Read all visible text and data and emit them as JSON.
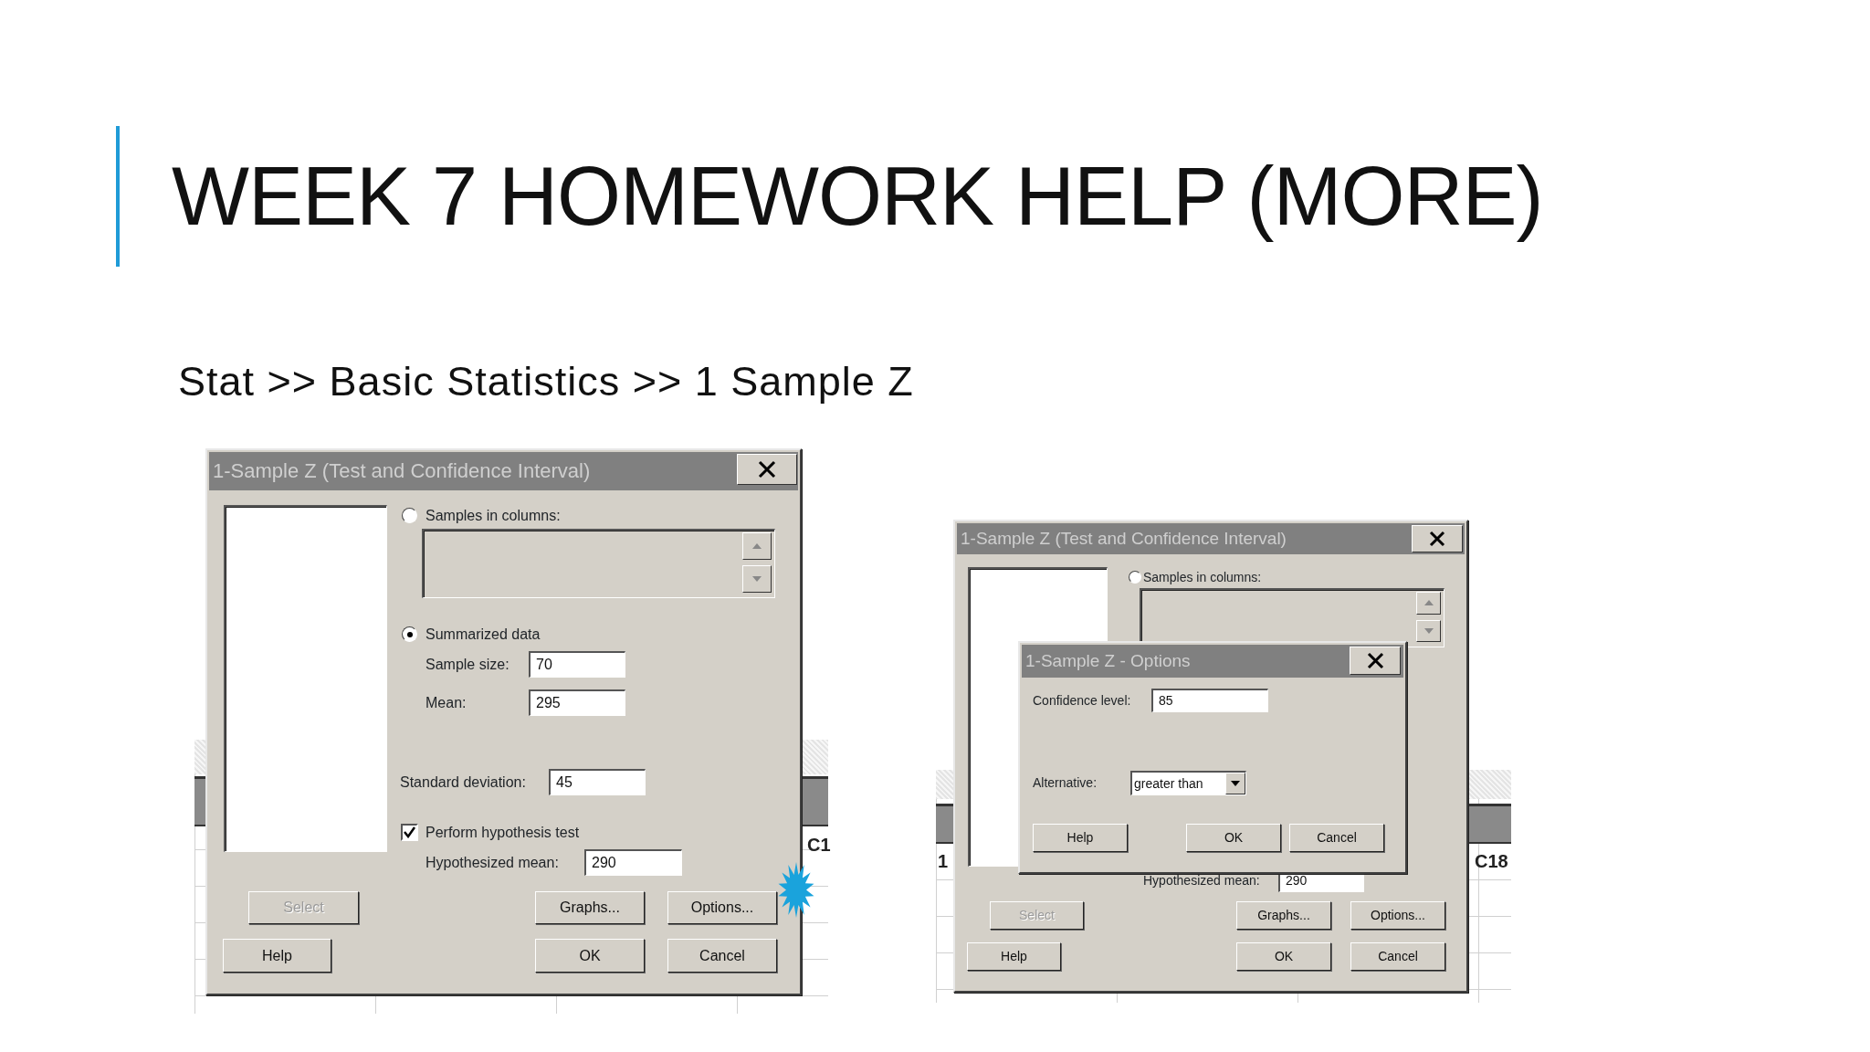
{
  "slide": {
    "title": "WEEK 7 HOMEWORK HELP (MORE)",
    "subtitle": "Stat >> Basic Statistics >> 1 Sample Z"
  },
  "worksheets": [
    {
      "labels": [
        "C1"
      ]
    },
    {
      "labels": [
        "1",
        "C18"
      ]
    }
  ],
  "dialogs": [
    {
      "title": "1-Sample Z (Test and Confidence Interval)",
      "items": [
        {
          "kind": "radio",
          "label": "Samples in columns:",
          "selected": false
        },
        {
          "kind": "radio",
          "label": "Summarized data",
          "selected": true
        },
        {
          "kind": "field",
          "label": "Sample size:",
          "value": "70"
        },
        {
          "kind": "field",
          "label": "Mean:",
          "value": "295"
        },
        {
          "kind": "field",
          "label": "Standard deviation:",
          "value": "45"
        },
        {
          "kind": "checkbox",
          "label": "Perform hypothesis test",
          "checked": true
        },
        {
          "kind": "field",
          "label": "Hypothesized mean:",
          "value": "290"
        },
        {
          "kind": "button",
          "label": "Select",
          "disabled": true,
          "highlighted": false
        },
        {
          "kind": "button",
          "label": "Graphs...",
          "disabled": false,
          "highlighted": false
        },
        {
          "kind": "button",
          "label": "Options...",
          "disabled": false,
          "highlighted": true
        },
        {
          "kind": "button",
          "label": "Help",
          "disabled": false,
          "highlighted": false
        },
        {
          "kind": "button",
          "label": "OK",
          "disabled": false,
          "highlighted": false
        },
        {
          "kind": "button",
          "label": "Cancel",
          "disabled": false,
          "highlighted": false
        }
      ]
    },
    {
      "title": "1-Sample Z (Test and Confidence Interval)",
      "items": [
        {
          "kind": "radio",
          "label": "Samples in columns:",
          "selected": false
        },
        {
          "kind": "field",
          "label": "Hypothesized mean:",
          "value": "290"
        },
        {
          "kind": "button",
          "label": "Select",
          "disabled": true,
          "highlighted": false
        },
        {
          "kind": "button",
          "label": "Graphs...",
          "disabled": false,
          "highlighted": false
        },
        {
          "kind": "button",
          "label": "Options...",
          "disabled": false,
          "highlighted": false
        },
        {
          "kind": "button",
          "label": "Help",
          "disabled": false,
          "highlighted": false
        },
        {
          "kind": "button",
          "label": "OK",
          "disabled": false,
          "highlighted": false
        },
        {
          "kind": "button",
          "label": "Cancel",
          "disabled": false,
          "highlighted": false
        }
      ],
      "child": {
        "title": "1-Sample Z - Options",
        "items": [
          {
            "kind": "field",
            "label": "Confidence level:",
            "value": "85"
          },
          {
            "kind": "dropdown",
            "label": "Alternative:",
            "value": "greater than"
          },
          {
            "kind": "button",
            "label": "Help",
            "disabled": false,
            "highlighted": false
          },
          {
            "kind": "button",
            "label": "OK",
            "disabled": false,
            "highlighted": false
          },
          {
            "kind": "button",
            "label": "Cancel",
            "disabled": false,
            "highlighted": false
          }
        ]
      }
    }
  ]
}
